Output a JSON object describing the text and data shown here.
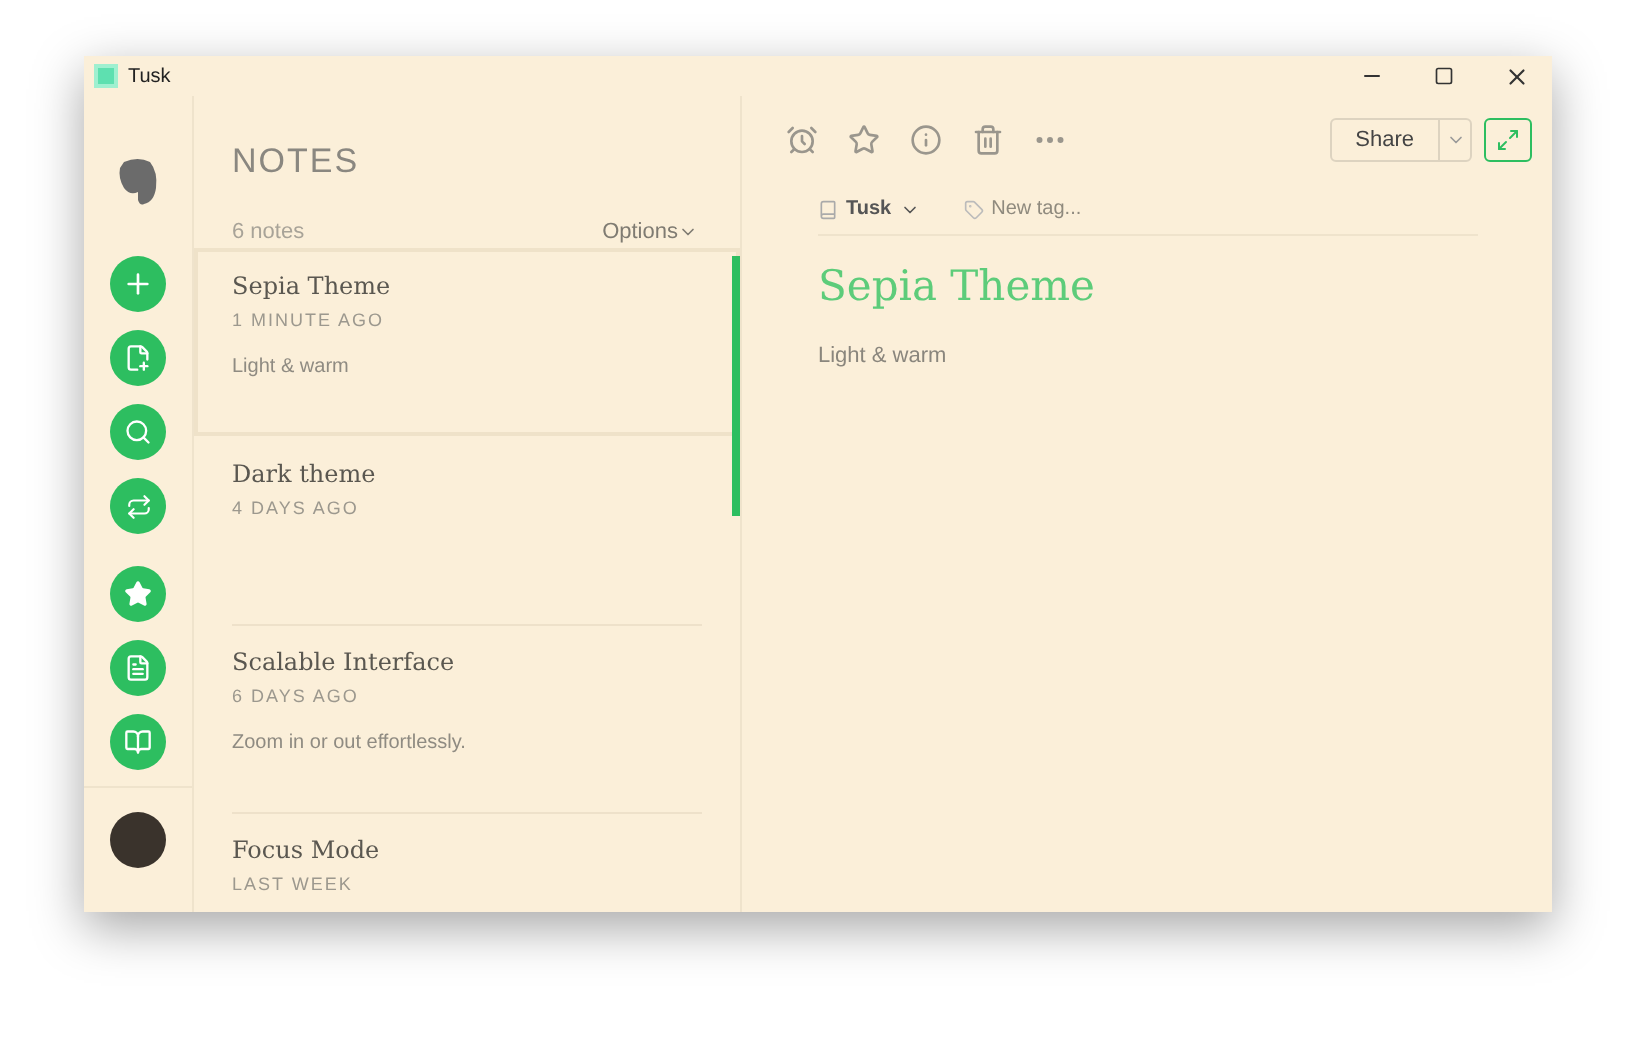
{
  "window": {
    "title": "Tusk"
  },
  "notes": {
    "heading": "NOTES",
    "count": "6 notes",
    "options": "Options",
    "items": [
      {
        "title": "Sepia Theme",
        "time": "1 MINUTE AGO",
        "snippet": "Light & warm",
        "selected": true
      },
      {
        "title": "Dark theme",
        "time": "4 DAYS AGO",
        "selected": false
      },
      {
        "title": "Scalable Interface",
        "time": "6 DAYS AGO",
        "snippet": "Zoom in or out effortlessly.",
        "selected": false
      },
      {
        "title": "Focus Mode",
        "time": "LAST WEEK",
        "selected": false
      }
    ]
  },
  "editor": {
    "share": "Share",
    "notebook": "Tusk",
    "tag_placeholder": "New tag...",
    "title": "Sepia Theme",
    "body": "Light & warm"
  }
}
